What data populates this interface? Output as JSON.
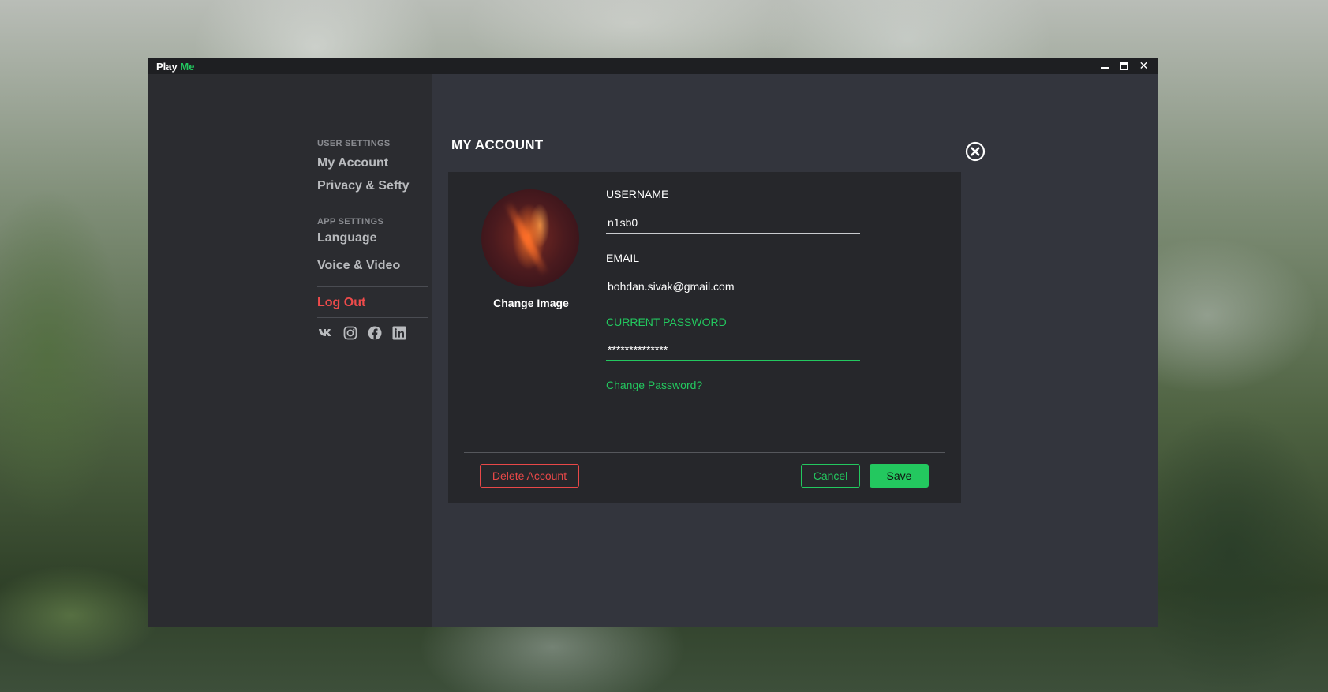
{
  "window": {
    "title_primary": "Play",
    "title_accent": "Me",
    "accent_color": "#23c85f",
    "controls": [
      "minimize-icon",
      "maximize-icon",
      "close-icon"
    ],
    "close_glyph": "✕"
  },
  "sidebar": {
    "user_settings_header": "USER SETTINGS",
    "user_items": [
      "My Account",
      "Privacy & Sefty"
    ],
    "app_settings_header": "APP SETTINGS",
    "app_items": [
      "Language",
      "Voice & Video"
    ],
    "logout_label": "Log Out",
    "logout_color": "#ee4b4b",
    "socials": [
      "vk-icon",
      "instagram-icon",
      "facebook-icon",
      "linkedin-icon"
    ]
  },
  "account": {
    "page_title": "MY ACCOUNT",
    "change_image_label": "Change Image",
    "username_label": "USERNAME",
    "username_value": "n1sb0",
    "email_label": "EMAIL",
    "email_value": "bohdan.sivak@gmail.com",
    "password_label": "CURRENT PASSWORD",
    "password_value": "**************",
    "change_password_link": "Change Password?",
    "delete_button": "Delete Account",
    "cancel_button": "Cancel",
    "save_button": "Save"
  }
}
